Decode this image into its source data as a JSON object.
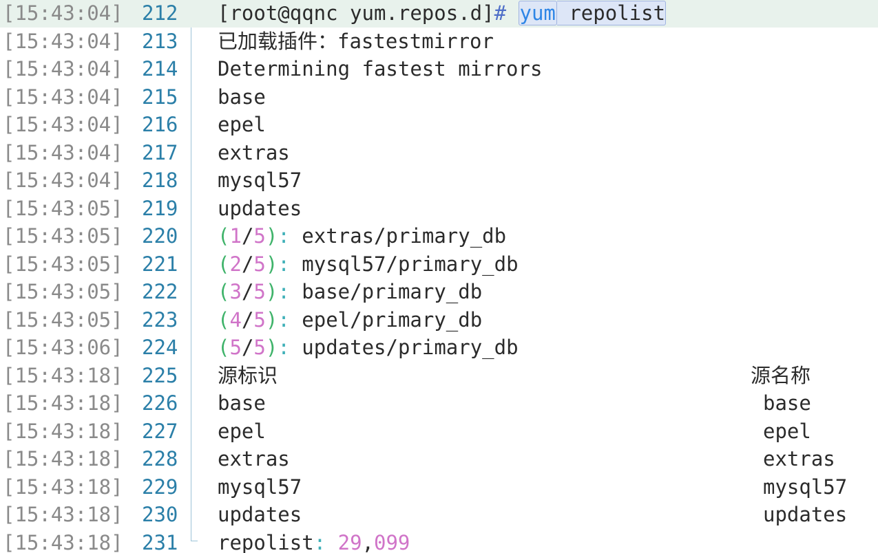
{
  "lines": [
    {
      "ts": "[15:43:04]",
      "ln": "212",
      "text": "[root@qqnc yum.repos.d]# yum repolist"
    },
    {
      "ts": "[15:43:04]",
      "ln": "213",
      "text": "已加载插件：fastestmirror"
    },
    {
      "ts": "[15:43:04]",
      "ln": "214",
      "text": "Determining fastest mirrors"
    },
    {
      "ts": "[15:43:04]",
      "ln": "215",
      "text": "base"
    },
    {
      "ts": "[15:43:04]",
      "ln": "216",
      "text": "epel"
    },
    {
      "ts": "[15:43:04]",
      "ln": "217",
      "text": "extras"
    },
    {
      "ts": "[15:43:04]",
      "ln": "218",
      "text": "mysql57"
    },
    {
      "ts": "[15:43:05]",
      "ln": "219",
      "text": "updates"
    },
    {
      "ts": "[15:43:05]",
      "ln": "220",
      "text": "(1/5): extras/primary_db"
    },
    {
      "ts": "[15:43:05]",
      "ln": "221",
      "text": "(2/5): mysql57/primary_db"
    },
    {
      "ts": "[15:43:05]",
      "ln": "222",
      "text": "(3/5): base/primary_db"
    },
    {
      "ts": "[15:43:05]",
      "ln": "223",
      "text": "(4/5): epel/primary_db"
    },
    {
      "ts": "[15:43:06]",
      "ln": "224",
      "text": "(5/5): updates/primary_db"
    },
    {
      "ts": "[15:43:18]",
      "ln": "225",
      "text": "源标识",
      "right": "源名称"
    },
    {
      "ts": "[15:43:18]",
      "ln": "226",
      "text": "base",
      "right": "base"
    },
    {
      "ts": "[15:43:18]",
      "ln": "227",
      "text": "epel",
      "right": "epel"
    },
    {
      "ts": "[15:43:18]",
      "ln": "228",
      "text": "extras",
      "right": "extras"
    },
    {
      "ts": "[15:43:18]",
      "ln": "229",
      "text": "mysql57",
      "right": "mysql57"
    },
    {
      "ts": "[15:43:18]",
      "ln": "230",
      "text": "updates",
      "right": "updates"
    },
    {
      "ts": "[15:43:18]",
      "ln": "231",
      "text": "repolist: 29,099"
    }
  ],
  "colors": {
    "timestamp": "#8a8a8a",
    "line_number": "#2b7fa8",
    "text": "#2b2b2b",
    "current_line_bg": "#e8f2ec",
    "keyword": "#2f86e6",
    "paren": "#3fb36a",
    "number": "#d074c8"
  },
  "icons": {
    "fold": "fold-minus-icon"
  }
}
